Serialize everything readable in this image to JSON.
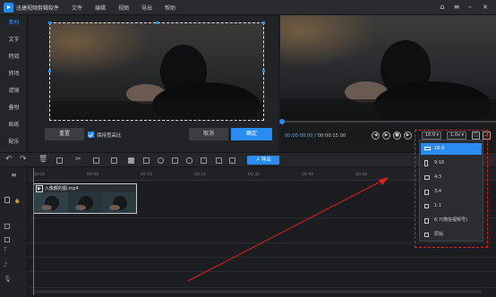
{
  "titlebar": {
    "app_title": "迅捷视频剪辑软件",
    "menus": [
      "文件",
      "编辑",
      "视图",
      "导出",
      "帮助"
    ]
  },
  "sidebar": {
    "items": [
      {
        "label": "素材",
        "active": true
      },
      {
        "label": "文字",
        "active": false
      },
      {
        "label": "特效",
        "active": false
      },
      {
        "label": "转场",
        "active": false
      },
      {
        "label": "滤镜",
        "active": false
      },
      {
        "label": "叠附",
        "active": false
      },
      {
        "label": "贴纸",
        "active": false
      },
      {
        "label": "配乐",
        "active": false
      }
    ]
  },
  "crop_panel": {
    "reset_label": "重置",
    "keep_ratio_label": "保持宽高比",
    "keep_ratio_checked": true,
    "cancel_label": "取消",
    "ok_label": "确定"
  },
  "preview": {
    "time_current": "00:00:00.00",
    "time_total": "/ 00:00:15.00",
    "ratio_select": "16:9",
    "speed_select": "1.0x"
  },
  "toolbar": {
    "export_label": "导出"
  },
  "timeline": {
    "ruler_ticks": [
      "00:00",
      "00:08",
      "00:16",
      "00:24",
      "00:32",
      "00:40",
      "00:48"
    ],
    "clip_name": "入像都的图.mp4"
  },
  "aspect_dropdown": {
    "items": [
      {
        "label": "16:9",
        "selected": true
      },
      {
        "label": "9:16",
        "selected": false
      },
      {
        "label": "4:3",
        "selected": false
      },
      {
        "label": "3:4",
        "selected": false
      },
      {
        "label": "1:1",
        "selected": false
      },
      {
        "label": "6:7(微信视频号)",
        "selected": false
      },
      {
        "label": "原始",
        "selected": false
      }
    ]
  },
  "colors": {
    "accent": "#2a8cf0",
    "annotation_red": "#e0201c",
    "background": "#1e1f22"
  }
}
